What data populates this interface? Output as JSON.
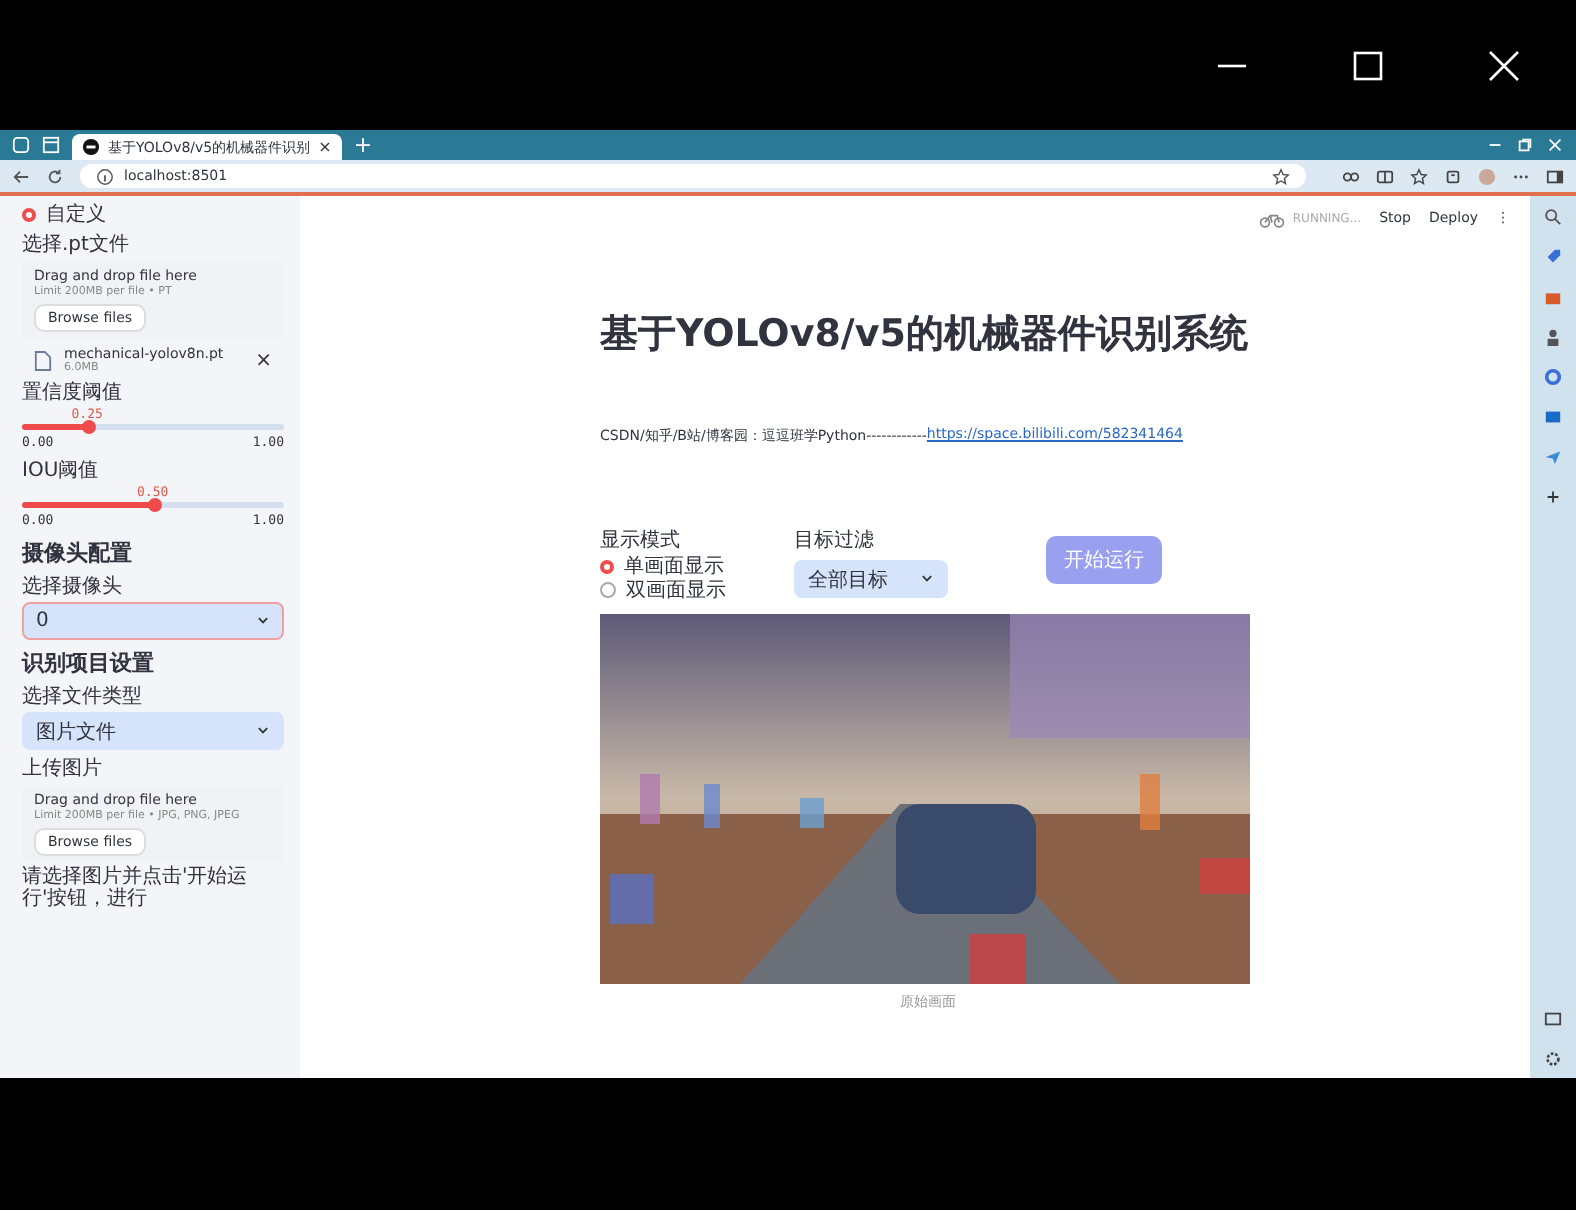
{
  "browser": {
    "tab_title": "基于YOLOv8/v5的机械器件识别",
    "tab_close": "×",
    "new_tab": "+",
    "url": "localhost:8501"
  },
  "toolbar": {
    "status": "RUNNING...",
    "buttons": [
      "Stop",
      "Deploy"
    ],
    "menu": "⋮"
  },
  "sidebar": {
    "model_option": {
      "label": "自定义",
      "selected": true
    },
    "model_uploader": {
      "label": "选择.pt文件",
      "drop_text": "Drag and drop file here",
      "limit": "Limit 200MB per file • PT",
      "browse": "Browse files"
    },
    "model_file": {
      "name": "mechanical-yolov8n.pt",
      "size": "6.0MB",
      "remove": "×"
    },
    "sliders": [
      {
        "label": "置信度阈值",
        "value": "0.25",
        "level": 0.25,
        "min": "0.00",
        "max": "1.00"
      },
      {
        "label": "IOU阈值",
        "value": "0.50",
        "level": 0.5,
        "min": "0.00",
        "max": "1.00"
      }
    ],
    "camera_header": "摄像头配置",
    "camera_label": "选择摄像头",
    "camera_value": "0",
    "project_header": "识别项目设置",
    "file_type_label": "选择文件类型",
    "file_type_value": "图片文件",
    "image_uploader": {
      "label": "上传图片",
      "drop_text": "Drag and drop file here",
      "limit": "Limit 200MB per file • JPG, PNG, JPEG",
      "browse": "Browse files"
    },
    "hint": "请选择图片并点击'开始运行'按钮，进行"
  },
  "main": {
    "title": "基于YOLOv8/v5的机械器件识别系统",
    "info_text": "CSDN/知乎/B站/博客园：逗逗班学Python------------",
    "link": "https://space.bilibili.com/582341464",
    "display_mode": {
      "label": "显示模式",
      "options": [
        {
          "label": "单画面显示",
          "selected": true
        },
        {
          "label": "双画面显示",
          "selected": false
        }
      ]
    },
    "filter": {
      "label": "目标过滤",
      "value": "全部目标"
    },
    "run_button": "开始运行",
    "caption": "原始画面"
  }
}
